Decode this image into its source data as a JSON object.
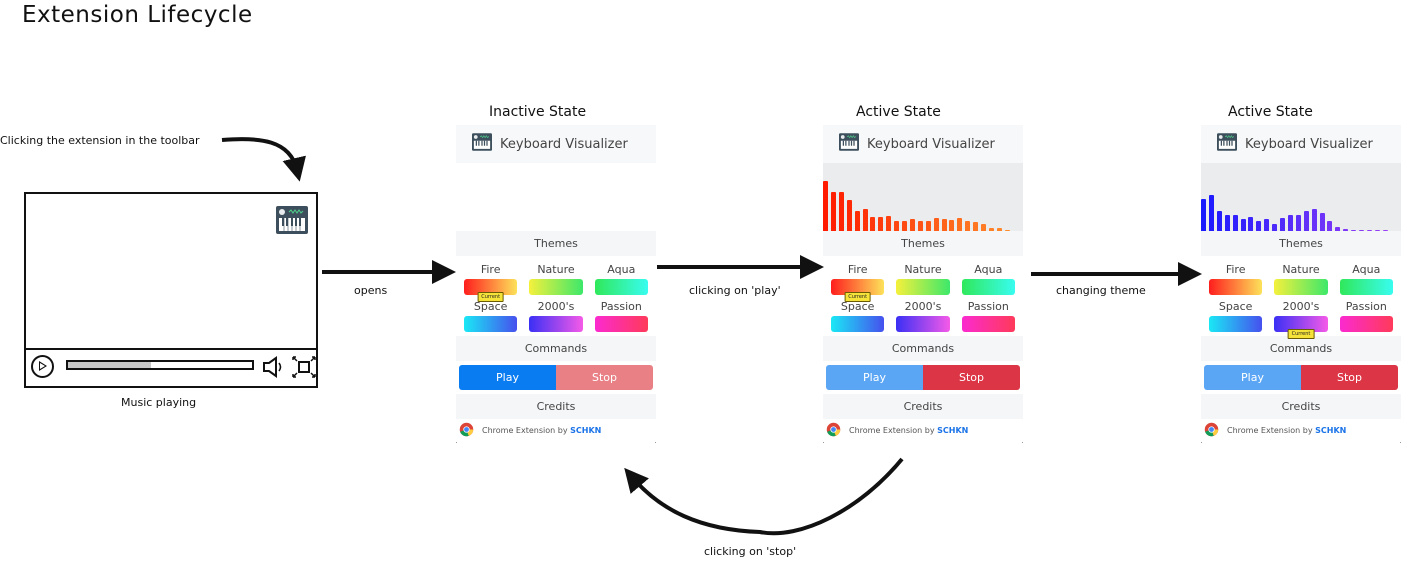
{
  "title": "Extension Lifecycle",
  "notes": {
    "toolbar_click": "Clicking the extension in the toolbar",
    "music_playing": "Music playing",
    "opens": "opens",
    "clicking_play": "clicking on 'play'",
    "changing_theme": "changing theme",
    "clicking_stop": "clicking on 'stop'"
  },
  "player": {
    "progress_fraction": 0.45,
    "icons": [
      "play-icon",
      "volume-icon",
      "fullscreen-icon",
      "extension-icon"
    ]
  },
  "colors": {
    "play_blue": "#0a7cf2",
    "play_blue_disabled": "#5aa6f5",
    "stop_red": "#dc3545",
    "stop_red_disabled": "#e88085",
    "author_link": "#1a73e8"
  },
  "panels": [
    {
      "state_label": "Inactive State",
      "header_title": "Keyboard Visualizer",
      "active": false,
      "themes_label": "Themes",
      "commands_label": "Commands",
      "credits_label": "Credits",
      "play_label": "Play",
      "stop_label": "Stop",
      "credit_text": "Chrome Extension by",
      "credit_author": "SCHKN",
      "current_theme": "Fire",
      "current_badge": "Current",
      "bars": []
    },
    {
      "state_label": "Active State",
      "header_title": "Keyboard Visualizer",
      "active": true,
      "themes_label": "Themes",
      "commands_label": "Commands",
      "credits_label": "Credits",
      "play_label": "Play",
      "stop_label": "Stop",
      "credit_text": "Chrome Extension by",
      "credit_author": "SCHKN",
      "current_theme": "Fire",
      "current_badge": "Current",
      "bar_colors": [
        "#ff1a00",
        "#ff8a2a"
      ],
      "bars": [
        0.73,
        0.57,
        0.57,
        0.46,
        0.29,
        0.33,
        0.2,
        0.2,
        0.22,
        0.15,
        0.15,
        0.17,
        0.14,
        0.15,
        0.19,
        0.18,
        0.16,
        0.19,
        0.15,
        0.13,
        0.1,
        0.05,
        0.04,
        0.02
      ]
    },
    {
      "state_label": "Active State",
      "header_title": "Keyboard Visualizer",
      "active": true,
      "themes_label": "Themes",
      "commands_label": "Commands",
      "credits_label": "Credits",
      "play_label": "Play",
      "stop_label": "Stop",
      "credit_text": "Chrome Extension by",
      "credit_author": "SCHKN",
      "current_theme": "2000's",
      "current_badge": "Current",
      "bar_colors": [
        "#1a1aff",
        "#9a40f5"
      ],
      "bars": [
        0.47,
        0.53,
        0.3,
        0.23,
        0.23,
        0.17,
        0.21,
        0.14,
        0.18,
        0.1,
        0.19,
        0.23,
        0.23,
        0.29,
        0.32,
        0.26,
        0.14,
        0.06,
        0.03,
        0.02,
        0.01,
        0.02,
        0.02,
        0.01
      ]
    }
  ],
  "themes": [
    {
      "name": "Fire",
      "from": "#ff1e1e",
      "to": "#fde25a"
    },
    {
      "name": "Nature",
      "from": "#f5f03c",
      "to": "#3de86a"
    },
    {
      "name": "Aqua",
      "from": "#30e85a",
      "to": "#38fcf0"
    },
    {
      "name": "Space",
      "from": "#1ae8f5",
      "to": "#4650ee"
    },
    {
      "name": "2000's",
      "from": "#3a30f5",
      "to": "#f55ae8"
    },
    {
      "name": "Passion",
      "from": "#fb2ad0",
      "to": "#ff3a5a"
    }
  ]
}
